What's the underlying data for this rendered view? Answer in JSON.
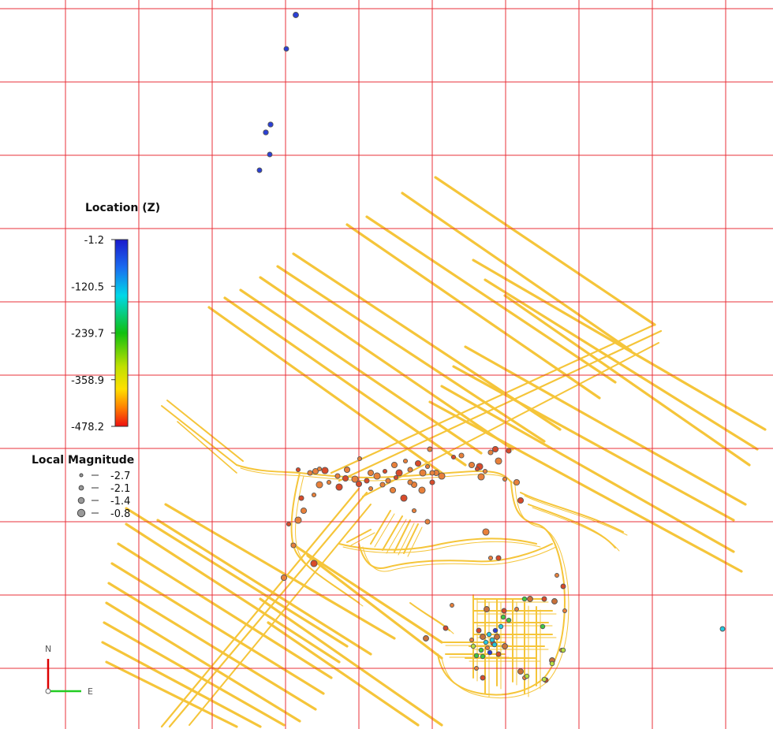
{
  "legends": {
    "location": {
      "title": "Location (Z)",
      "ticks": [
        "-1.2",
        "-120.5",
        "-239.7",
        "-358.9",
        "-478.2"
      ],
      "colors": [
        "#1a1acc",
        "#1a6cf0",
        "#00d8e8",
        "#10c010",
        "#c0e000",
        "#ffe000",
        "#ff8000",
        "#ee1010"
      ]
    },
    "magnitude": {
      "title": "Local Magnitude",
      "entries": [
        {
          "label": "-2.7"
        },
        {
          "label": "-2.1"
        },
        {
          "label": "-1.4"
        },
        {
          "label": "-0.8"
        }
      ]
    }
  },
  "compass": {
    "north_label": "N",
    "east_label": "E",
    "north_color": "#dd0000",
    "east_color": "#22cc22"
  },
  "map": {
    "grid_color": "#e8303a",
    "tunnel_color": "#f5c53a",
    "event_stroke": "#555555"
  }
}
